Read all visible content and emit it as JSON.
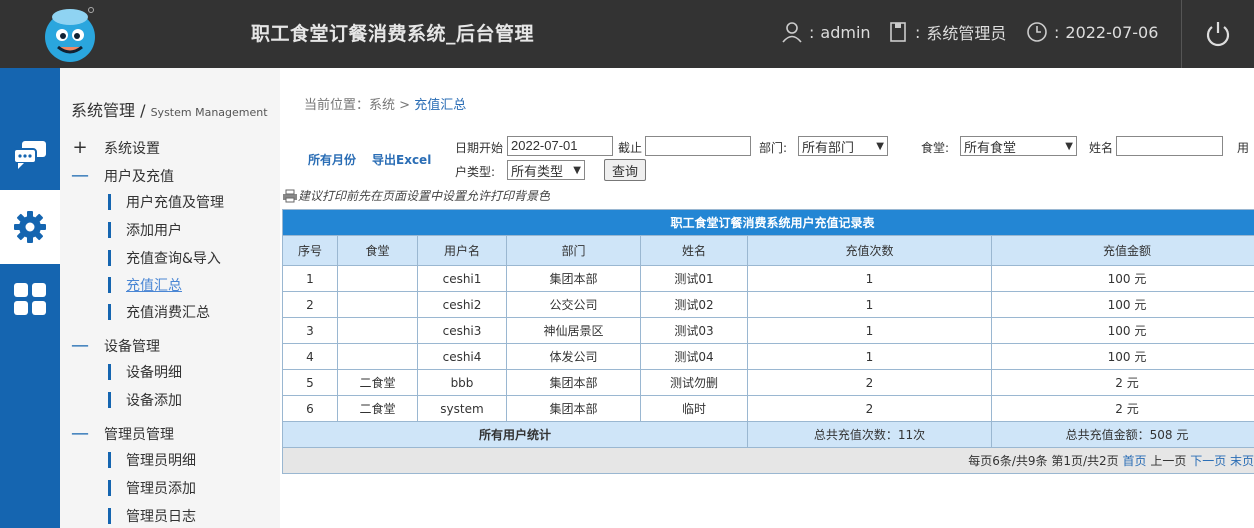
{
  "header": {
    "title": "职工食堂订餐消费系统_后台管理",
    "user": "admin",
    "role": "系统管理员",
    "date": "2022-07-06"
  },
  "sidebar": {
    "title": "系统管理 /",
    "title_en": "System Management",
    "groups": [
      {
        "label": "系统设置",
        "state": "collapsed"
      },
      {
        "label": "用户及充值",
        "state": "expanded"
      },
      {
        "label": "设备管理",
        "state": "expanded"
      },
      {
        "label": "管理员管理",
        "state": "expanded"
      }
    ],
    "items": [
      "用户充值及管理",
      "添加用户",
      "充值查询&导入",
      "充值汇总",
      "充值消费汇总",
      "设备明细",
      "设备添加",
      "管理员明细",
      "管理员添加",
      "管理员日志"
    ]
  },
  "breadcrumb": {
    "prefix": "当前位置：",
    "parent": "系统",
    "sep": ">",
    "current": "充值汇总"
  },
  "toolbar": {
    "all_months": "所有月份",
    "export_excel": "导出Excel",
    "date_start_label": "日期开始",
    "date_start_value": "2022-07-01",
    "date_end_label": "截止",
    "date_end_value": "",
    "dept_label": "部门:",
    "dept_value": "所有部门",
    "canteen_label": "食堂:",
    "canteen_value": "所有食堂",
    "name_label": "姓名",
    "name_value": "",
    "user_type_label_1": "用",
    "user_type_label_2": "户类型:",
    "user_type_value": "所有类型",
    "query_button": "查询"
  },
  "print_tip": "建议打印前先在页面设置中设置允许打印背景色",
  "table": {
    "title": "职工食堂订餐消费系统用户充值记录表",
    "columns": [
      "序号",
      "食堂",
      "用户名",
      "部门",
      "姓名",
      "充值次数",
      "充值金额"
    ],
    "rows": [
      [
        "1",
        "",
        "ceshi1",
        "集团本部",
        "测试01",
        "1",
        "100 元"
      ],
      [
        "2",
        "",
        "ceshi2",
        "公交公司",
        "测试02",
        "1",
        "100 元"
      ],
      [
        "3",
        "",
        "ceshi3",
        "神仙居景区",
        "测试03",
        "1",
        "100 元"
      ],
      [
        "4",
        "",
        "ceshi4",
        "体发公司",
        "测试04",
        "1",
        "100 元"
      ],
      [
        "5",
        "二食堂",
        "bbb",
        "集团本部",
        "测试勿删",
        "2",
        "2 元"
      ],
      [
        "6",
        "二食堂",
        "system",
        "集团本部",
        "临时",
        "2",
        "2 元"
      ]
    ],
    "summary": {
      "label": "所有用户统计",
      "total_count": "总共充值次数：11次",
      "total_amount": "总共充值金额：508 元"
    },
    "pager": {
      "info": "每页6条/共9条 第1页/共2页",
      "first": "首页",
      "prev": "上一页",
      "next": "下一页",
      "last": "末页"
    }
  },
  "colors": {
    "accent": "#1565b0",
    "header_bg": "#333333",
    "table_title_bg": "#2386d4",
    "table_head_bg": "#cfe5f8"
  }
}
